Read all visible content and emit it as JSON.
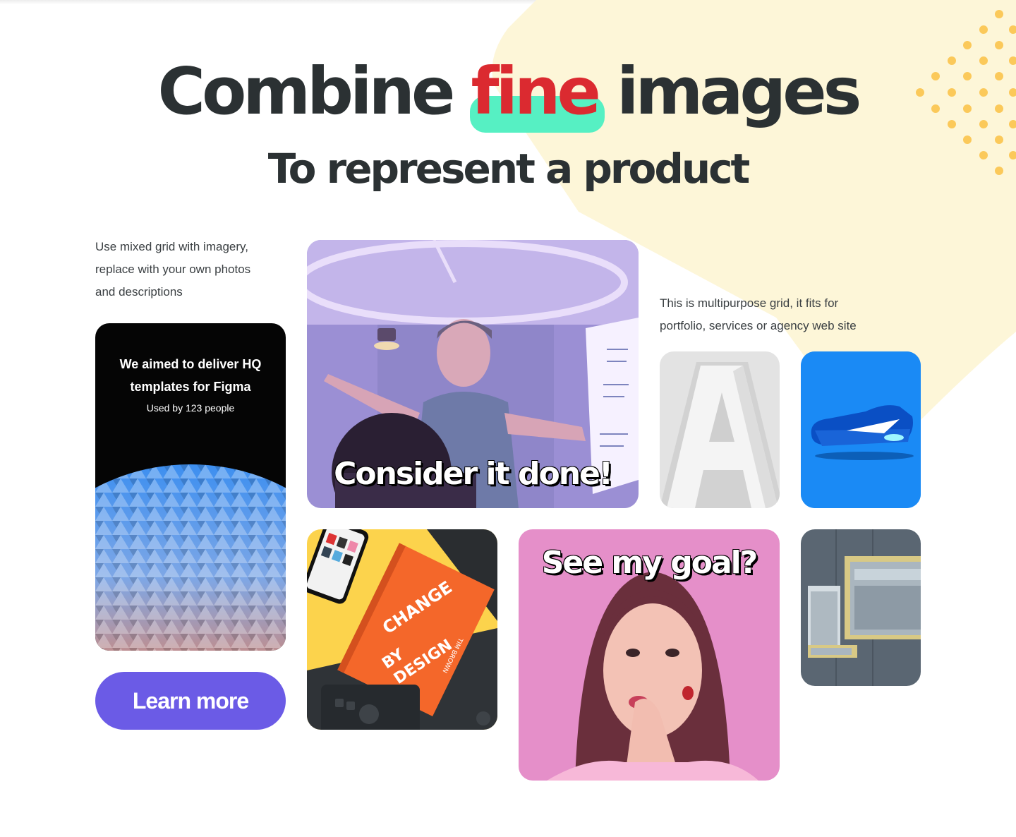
{
  "hero": {
    "title_before": "Combine",
    "title_highlight": "fine",
    "title_after": "images",
    "subtitle": "To represent a product"
  },
  "intro_left": {
    "line1": "Use mixed grid with imagery,",
    "line2": "replace with your own photos",
    "line3": "and descriptions"
  },
  "intro_right": {
    "line1": "This is multipurpose grid, it fits for",
    "line2": "portfolio, services or agency web site"
  },
  "feature_card": {
    "title_line1": "We aimed to deliver HQ",
    "title_line2": "templates for Figma",
    "subtitle": "Used by 123 people"
  },
  "overlays": {
    "presenter": "Consider it done!",
    "woman": "See my goal?"
  },
  "book": {
    "title1": "CHANGE",
    "title2": "BY",
    "title3": "DESIGN",
    "author": "TIM BROWN"
  },
  "letter_tile": "A",
  "cta": {
    "label": "Learn more"
  },
  "colors": {
    "heading": "#2b3133",
    "highlight_text": "#db2a30",
    "highlight_bar": "#56f0c3",
    "blob": "#fdf6d8",
    "dots": "#fbc95a",
    "button": "#6b5be6",
    "shoe_bg": "#1a8af5",
    "woman_bg": "#e58fc9"
  }
}
